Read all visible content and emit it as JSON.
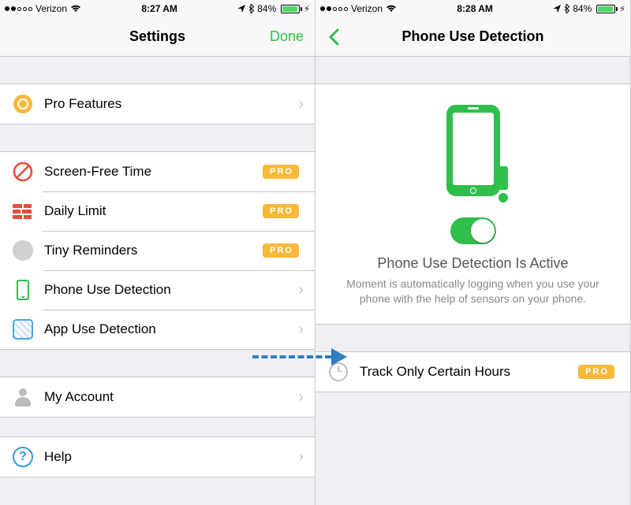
{
  "left": {
    "status": {
      "carrier": "Verizon",
      "time": "8:27 AM",
      "battery_pct": "84%"
    },
    "nav": {
      "title": "Settings",
      "done": "Done"
    },
    "rows": {
      "pro_features": "Pro Features",
      "screen_free": "Screen-Free Time",
      "daily_limit": "Daily Limit",
      "tiny_reminders": "Tiny Reminders",
      "phone_use": "Phone Use Detection",
      "app_use": "App Use Detection",
      "my_account": "My Account",
      "help": "Help"
    },
    "pro_badge": "PRO"
  },
  "right": {
    "status": {
      "carrier": "Verizon",
      "time": "8:28 AM",
      "battery_pct": "84%"
    },
    "nav": {
      "title": "Phone Use Detection"
    },
    "hero": {
      "heading": "Phone Use Detection Is Active",
      "desc": "Moment is automatically logging when you use your phone with the help of sensors on your phone."
    },
    "track_row": "Track Only Certain Hours",
    "pro_badge": "PRO"
  }
}
